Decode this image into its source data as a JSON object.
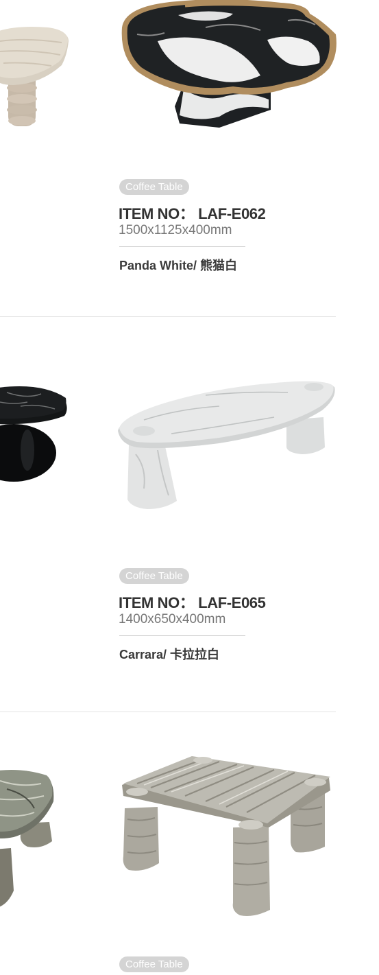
{
  "products": [
    {
      "category": "Coffee Table",
      "item_no": "ITEM NO： LAF-E062",
      "dimensions": "1500x1125x400mm",
      "material": "Panda White/ 熊猫白"
    },
    {
      "category": "Coffee Table",
      "item_no": "ITEM NO： LAF-E065",
      "dimensions": "1400x650x400mm",
      "material": "Carrara/ 卡拉拉白"
    },
    {
      "category": "Coffee Table"
    }
  ],
  "colors": {
    "tag_background": "#d4d4d4",
    "tag_text": "#ffffff",
    "title_text": "#333333",
    "dimension_text": "#777777",
    "divider": "#e4e4e4",
    "brass_rim": "#b08d5e",
    "panda_black": "#1f2224",
    "carrara_white": "#e6e7e7",
    "travertine_grey": "#a9a9a2"
  },
  "icons": [
    "travertine-round-table-photo",
    "panda-white-table-photo",
    "black-marble-round-table-photo",
    "carrara-oval-table-photo",
    "green-marble-table-photo",
    "travertine-square-table-photo"
  ]
}
